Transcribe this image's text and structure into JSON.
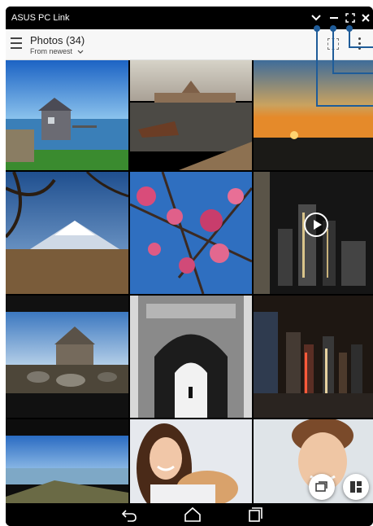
{
  "window": {
    "title": "ASUS PC Link",
    "controls": [
      "minimize-arrow-icon",
      "minimize-icon",
      "fullscreen-icon",
      "close-icon"
    ]
  },
  "appbar": {
    "title": "Photos (34)",
    "sort_label": "From newest",
    "icons": [
      "menu-icon",
      "select-icon",
      "more-options-icon"
    ]
  },
  "photos": [
    {
      "subject": "lake house",
      "type": "photo"
    },
    {
      "subject": "harbor with boats",
      "type": "photo"
    },
    {
      "subject": "sunset over water",
      "type": "photo"
    },
    {
      "subject": "mount fuji",
      "type": "photo"
    },
    {
      "subject": "cherry blossoms",
      "type": "photo"
    },
    {
      "subject": "city skyline at night",
      "type": "video"
    },
    {
      "subject": "stone church",
      "type": "photo"
    },
    {
      "subject": "stone archway",
      "type": "photo"
    },
    {
      "subject": "night skyscrapers",
      "type": "photo"
    },
    {
      "subject": "coastal hillside",
      "type": "photo"
    },
    {
      "subject": "smiling woman",
      "type": "photo"
    },
    {
      "subject": "smiling man",
      "type": "photo"
    }
  ],
  "fabs": [
    "screenshot-icon",
    "layout-icon"
  ],
  "navbar": [
    "back-icon",
    "home-icon",
    "recent-apps-icon"
  ],
  "colors": {
    "callout": "#1f5c99",
    "appbar_bg": "#f7f7f7",
    "window_bg": "#000000"
  }
}
